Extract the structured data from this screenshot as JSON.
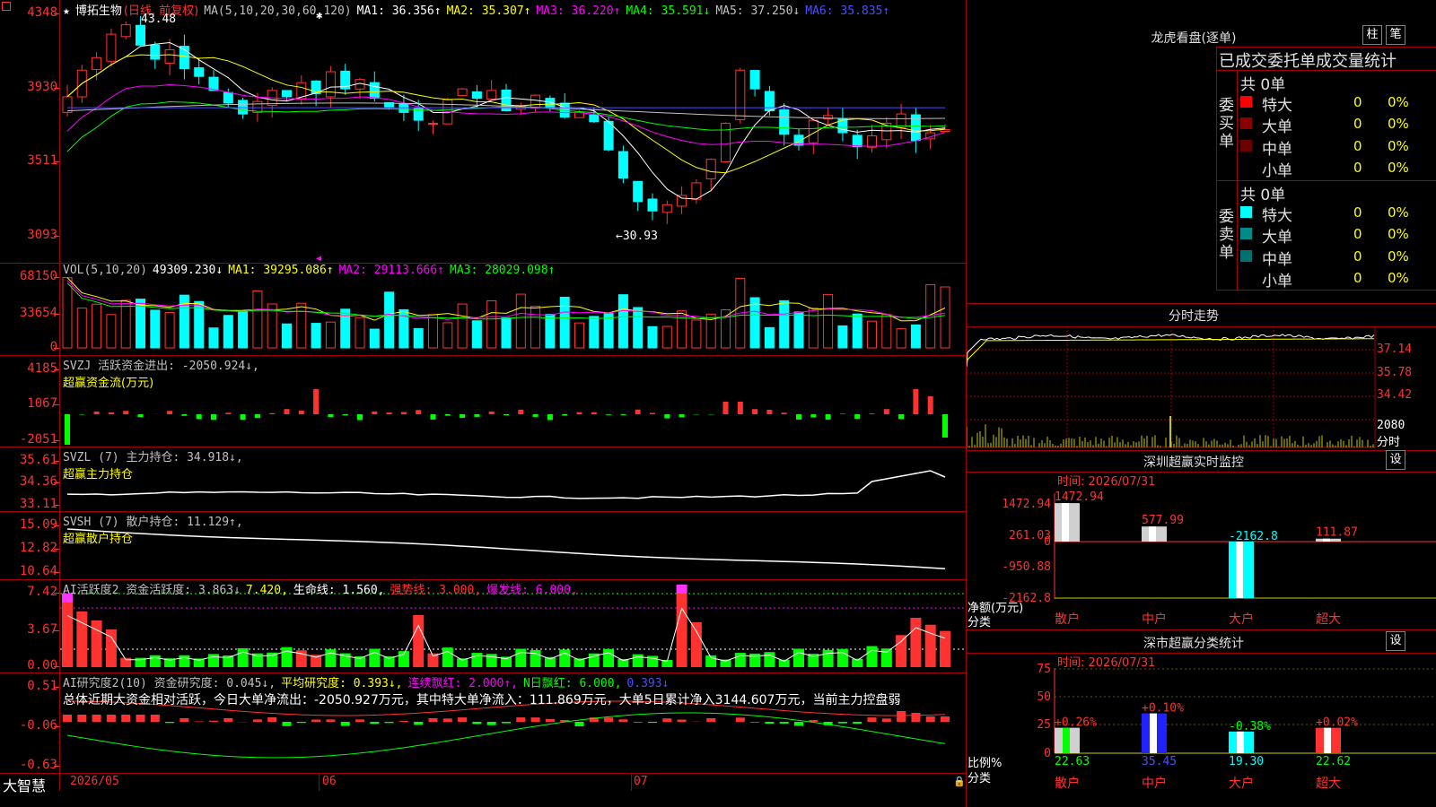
{
  "stock": {
    "star": "★",
    "name": "博拓生物",
    "mode": "(日线, 前复权)"
  },
  "main_legend": [
    {
      "text": "MA(5,10,20,30,60,120)",
      "color": "#c0c0c0"
    },
    {
      "text": "MA1: 36.356↑",
      "color": "#ffffff"
    },
    {
      "text": "MA2: 35.307↑",
      "color": "#ffff00"
    },
    {
      "text": "MA3: 36.220↑",
      "color": "#ff00ff"
    },
    {
      "text": "MA4: 35.591↓",
      "color": "#00ff00"
    },
    {
      "text": "MA5: 37.250↓",
      "color": "#c0c0c0"
    },
    {
      "text": "MA6: 35.835↑",
      "color": "#4d4dff"
    }
  ],
  "main_axis": [
    "4348",
    "3930",
    "3511",
    "3093"
  ],
  "annotations": {
    "high": "43.48",
    "low": "←30.93"
  },
  "vol_legend": [
    {
      "text": "VOL(5,10,20)",
      "color": "#c0c0c0"
    },
    {
      "text": "49309.230↓",
      "color": "#ffffff"
    },
    {
      "text": "MA1: 39295.086↑",
      "color": "#ffff00"
    },
    {
      "text": "MA2: 29113.666↑",
      "color": "#ff00ff"
    },
    {
      "text": "MA3: 28029.098↑",
      "color": "#00ff00"
    }
  ],
  "vol_axis": [
    "68150",
    "33654",
    "0"
  ],
  "svzj": {
    "legend": "SVZJ  活跃资金进出: -2050.924↓,",
    "sub": "超赢资金流(万元)",
    "axis": [
      "4185",
      "1067",
      "-2051"
    ]
  },
  "svzl": {
    "legend": "SVZL (7) 主力持仓: 34.918↓,",
    "sub": "超赢主力持仓",
    "axis": [
      "35.61",
      "34.36",
      "33.11"
    ]
  },
  "svsh": {
    "legend": "SVSH (7) 散户持仓: 11.129↑,",
    "sub": "超赢散户持仓",
    "axis": [
      "15.09",
      "12.82",
      "10.64"
    ]
  },
  "ai1": {
    "legend": [
      {
        "text": "AI活跃度2 资金活跃度: 3.863↓",
        "color": "#c0c0c0"
      },
      {
        "text": "7.420,",
        "color": "#ffff00"
      },
      {
        "text": "生命线: 1.560,",
        "color": "#ffffff"
      },
      {
        "text": "强势线: 3.000,",
        "color": "#ff3232"
      },
      {
        "text": "爆发线: 6.000,",
        "color": "#ff00ff"
      }
    ],
    "axis": [
      "7.42",
      "3.67",
      "0.00"
    ]
  },
  "ai2": {
    "legend": [
      {
        "text": "AI研究度2(10) 资金研究度: 0.045↓,",
        "color": "#c0c0c0"
      },
      {
        "text": "平均研究度: 0.393↓,",
        "color": "#ffff00"
      },
      {
        "text": "连续飘红: 2.000↑,",
        "color": "#ff00ff"
      },
      {
        "text": "N日飘红: 6.000,",
        "color": "#00ff00"
      },
      {
        "text": "0.393↓",
        "color": "#4d4dff"
      }
    ],
    "summary": "总体近期大资金相对活跃，今日大单净流出：-2050.927万元，其中特大单净流入：111.869万元，大单5日累计净入3144.607万元，当前主力控盘弱",
    "axis": [
      "0.51",
      "-0.06",
      "-0.63"
    ]
  },
  "bottom": {
    "logo": "大智慧",
    "dates": [
      "2026/05",
      "06",
      "07"
    ]
  },
  "right": {
    "lhb": {
      "title": "龙虎看盘(逐单)",
      "btn1": "柱",
      "btn2": "笔",
      "header": "已成交委托单成交量统计",
      "buy": {
        "label": "委买单",
        "total": "共 0单",
        "rows": [
          {
            "name": "特大",
            "val": "0",
            "pct": "0%",
            "color": "#ff0000"
          },
          {
            "name": "大单",
            "val": "0",
            "pct": "0%",
            "color": "#8b0000"
          },
          {
            "name": "中单",
            "val": "0",
            "pct": "0%",
            "color": "#6b0000"
          },
          {
            "name": "小单",
            "val": "0",
            "pct": "0%",
            "color": ""
          }
        ]
      },
      "sell": {
        "label": "委卖单",
        "total": "共 0单",
        "rows": [
          {
            "name": "特大",
            "val": "0",
            "pct": "0%",
            "color": "#00ffff"
          },
          {
            "name": "大单",
            "val": "0",
            "pct": "0%",
            "color": "#008b8b"
          },
          {
            "name": "中单",
            "val": "0",
            "pct": "0%",
            "color": "#007070"
          },
          {
            "name": "小单",
            "val": "0",
            "pct": "0%",
            "color": ""
          }
        ]
      }
    },
    "fenshi": {
      "title": "分时走势",
      "axis": [
        "37.14",
        "35.78",
        "34.42",
        "2080"
      ],
      "unit": "分时"
    },
    "sz_monitor": {
      "title": "深圳超赢实时监控",
      "btn": "设",
      "time": "时间: 2026/07/31",
      "axis": [
        "1472.94",
        "261.03",
        "0",
        "-950.88",
        "-2162.8"
      ],
      "bars": [
        {
          "cat": "散户",
          "value": "1472.94"
        },
        {
          "cat": "中户",
          "value": "577.99"
        },
        {
          "cat": "大户",
          "value": "-2162.8"
        },
        {
          "cat": "超大",
          "value": "111.87"
        }
      ],
      "ylabel": "净额(万元)",
      "xlabel": "分类"
    },
    "sz_stats": {
      "title": "深市超赢分类统计",
      "btn": "设",
      "time": "时间: 2026/07/31",
      "axis": [
        "75",
        "50",
        "25",
        "0"
      ],
      "bars": [
        {
          "cat": "散户",
          "pct": "+0.26%",
          "value": "22.63"
        },
        {
          "cat": "中户",
          "pct": "+0.10%",
          "value": "35.45"
        },
        {
          "cat": "大户",
          "pct": "-0.38%",
          "value": "19.30"
        },
        {
          "cat": "超大",
          "pct": "+0.02%",
          "value": "22.62"
        }
      ],
      "ylabel": "比例%",
      "xlabel": "分类"
    }
  }
}
